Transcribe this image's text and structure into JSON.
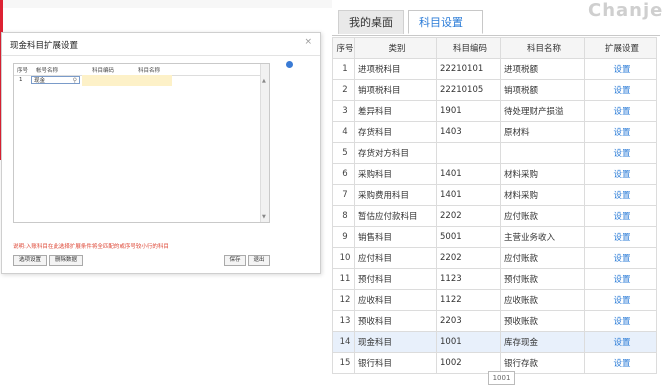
{
  "brand": {
    "text": "Chanje"
  },
  "tabs": [
    {
      "label": "我的桌面"
    },
    {
      "label": "科目设置",
      "close": "×"
    }
  ],
  "dialog": {
    "title": "现金科目扩展设置",
    "close": "×",
    "grid_headers": [
      "序号",
      "帐号名称",
      "科目编码",
      "科目名称"
    ],
    "row": {
      "seq": "1",
      "value": "现金"
    },
    "scroll_up": "▲",
    "scroll_down": "▼",
    "note": "说明:入账科目在此选择扩展条件将全匹配的或序号较小行的科目",
    "buttons": {
      "option": "选项设置",
      "clear": "删除数据",
      "save": "保存",
      "exit": "退出"
    }
  },
  "table": {
    "headers": [
      "序号",
      "类别",
      "科目编码",
      "科目名称",
      "扩展设置"
    ],
    "rows": [
      {
        "seq": "1",
        "category": "进项税科目",
        "code": "22210101",
        "name": "进项税额",
        "action": "设置"
      },
      {
        "seq": "2",
        "category": "销项税科目",
        "code": "22210105",
        "name": "销项税额",
        "action": "设置"
      },
      {
        "seq": "3",
        "category": "差异科目",
        "code": "1901",
        "name": "待处理财产损溢",
        "action": "设置"
      },
      {
        "seq": "4",
        "category": "存货科目",
        "code": "1403",
        "name": "原材料",
        "action": "设置"
      },
      {
        "seq": "5",
        "category": "存货对方科目",
        "code": "",
        "name": "",
        "action": "设置"
      },
      {
        "seq": "6",
        "category": "采购科目",
        "code": "1401",
        "name": "材料采购",
        "action": "设置"
      },
      {
        "seq": "7",
        "category": "采购费用科目",
        "code": "1401",
        "name": "材料采购",
        "action": "设置"
      },
      {
        "seq": "8",
        "category": "暂估应付款科目",
        "code": "2202",
        "name": "应付账款",
        "action": "设置"
      },
      {
        "seq": "9",
        "category": "销售科目",
        "code": "5001",
        "name": "主营业务收入",
        "action": "设置"
      },
      {
        "seq": "10",
        "category": "应付科目",
        "code": "2202",
        "name": "应付账款",
        "action": "设置"
      },
      {
        "seq": "11",
        "category": "预付科目",
        "code": "1123",
        "name": "预付账款",
        "action": "设置"
      },
      {
        "seq": "12",
        "category": "应收科目",
        "code": "1122",
        "name": "应收账款",
        "action": "设置"
      },
      {
        "seq": "13",
        "category": "预收科目",
        "code": "2203",
        "name": "预收账款",
        "action": "设置"
      },
      {
        "seq": "14",
        "category": "现金科目",
        "code": "1001",
        "name": "库存现金",
        "action": "设置"
      },
      {
        "seq": "15",
        "category": "银行科目",
        "code": "1002",
        "name": "银行存款",
        "action": "设置"
      }
    ],
    "highlight_row": 14
  },
  "tooltip": {
    "text": "1001"
  },
  "colors": {
    "accent": "#2a7bd7",
    "highlight": "#e8f0fb",
    "note": "#d43"
  }
}
